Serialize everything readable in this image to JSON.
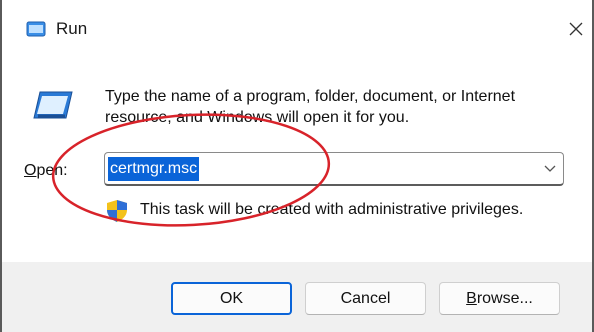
{
  "window": {
    "title": "Run",
    "icon": "run-dialog-icon",
    "close_glyph": "✕"
  },
  "dialog": {
    "description": "Type the name of a program, folder, document, or Internet resource, and Windows will open it for you.",
    "open_label_underlined": "O",
    "open_label_rest": "pen:",
    "open_value": "certmgr.msc",
    "admin_note": "This task will be created with administrative privileges."
  },
  "buttons": {
    "ok": "OK",
    "cancel": "Cancel",
    "browse_underlined": "B",
    "browse_rest": "rowse..."
  },
  "colors": {
    "accent": "#0a64d8",
    "annotation": "#d8232a"
  }
}
